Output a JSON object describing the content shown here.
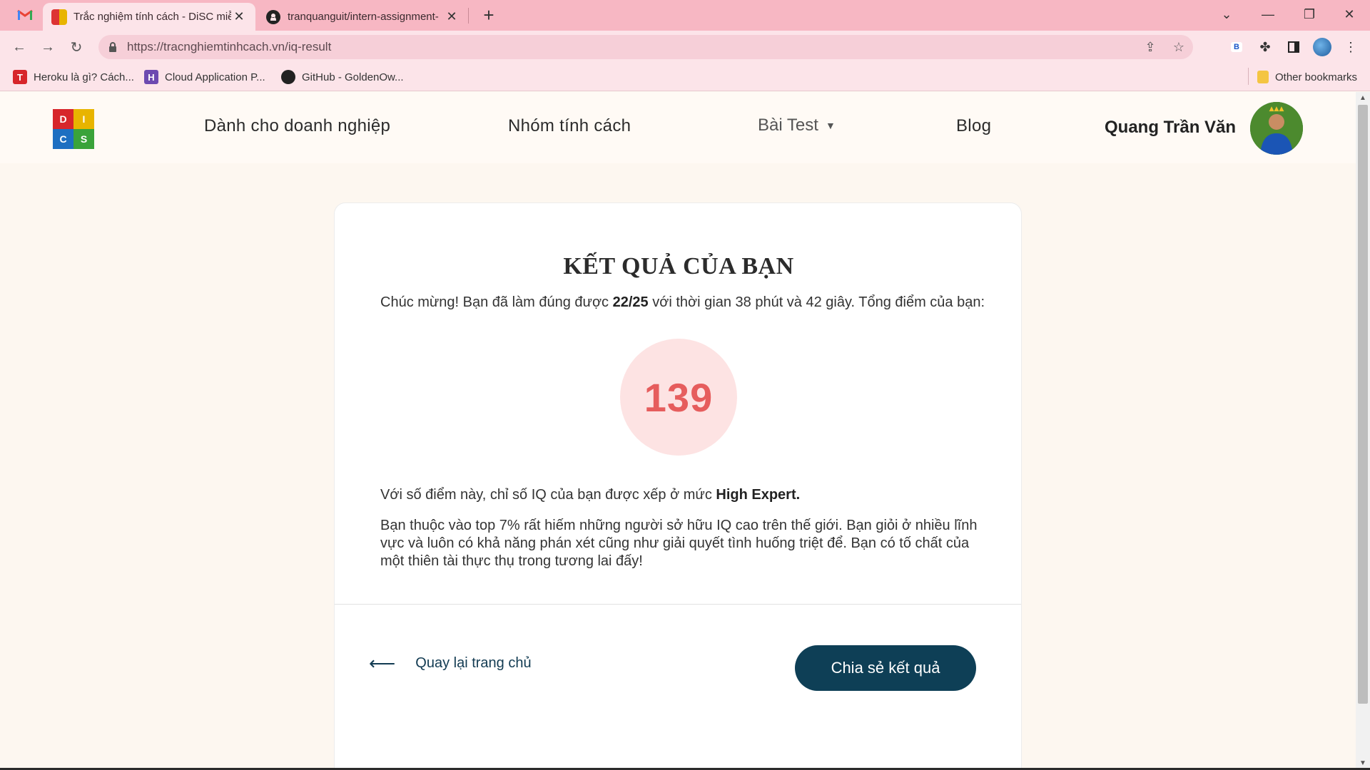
{
  "browser": {
    "tabs": [
      {
        "title": "Trắc nghiệm tính cách - DiSC miễ",
        "active": true,
        "favicon": "disc-logo-icon"
      },
      {
        "title": "tranquanguit/intern-assignment-",
        "active": false,
        "favicon": "github-icon"
      }
    ],
    "new_tab": "+",
    "url": "https://tracnghiemtinhcach.vn/iq-result",
    "extension_badge": "B",
    "bookmarks": [
      {
        "label": "Heroku là gì? Cách...",
        "icon_text": "T",
        "color": "#d7262b"
      },
      {
        "label": "Cloud Application P...",
        "icon_text": "H",
        "color": "#6d4ab0"
      },
      {
        "label": "GitHub - GoldenOw...",
        "icon_text": "",
        "color": "#222222"
      }
    ],
    "other_bookmarks": "Other bookmarks",
    "accent_color": "#f7b7c3"
  },
  "site": {
    "logo_letters": [
      "D",
      "I",
      "C",
      "S"
    ],
    "nav": {
      "business": "Dành cho doanh nghiệp",
      "personality_groups": "Nhóm tính cách",
      "tests": "Bài Test",
      "blog": "Blog"
    },
    "user_name": "Quang Trần Văn"
  },
  "result": {
    "title": "KẾT QUẢ CỦA BẠN",
    "intro_prefix": "Chúc mừng! Bạn đã làm đúng được ",
    "correct": "22/25",
    "intro_suffix": " với thời gian 38 phút và 42 giây. Tổng điểm của bạn:",
    "score": "139",
    "level_prefix": "Với số điểm này, chỉ số IQ của bạn được xếp ở mức ",
    "level": "High Expert.",
    "description": "Bạn thuộc vào top 7% rất hiếm những người sở hữu IQ cao trên thế giới. Bạn giỏi ở nhiều lĩnh vực và luôn có khả năng phán xét cũng như giải quyết tình huống triệt để. Bạn có tố chất của một thiên tài thực thụ trong tương lai đấy!",
    "back_label": "Quay lại trang chủ",
    "share_label": "Chia sẻ kết quả"
  },
  "colors": {
    "score": "#e65d5d",
    "score_bg": "#fde3e3",
    "button": "#0e3f56"
  }
}
